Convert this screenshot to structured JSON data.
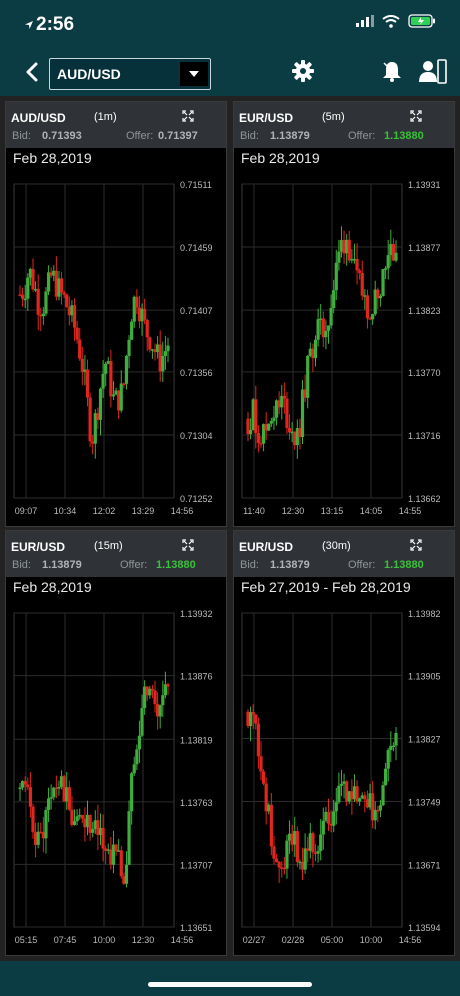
{
  "status": {
    "time": "2:56"
  },
  "nav": {
    "symbol": "AUD/USD"
  },
  "panels": [
    {
      "pair": "AUD/USD",
      "interval": "(1m)",
      "bid_label": "Bid:",
      "bid": "0.71393",
      "offer_label": "Offer:",
      "offer": "0.71397",
      "offer_color": "#b0b4b7",
      "date": "Feb 28,2019"
    },
    {
      "pair": "EUR/USD",
      "interval": "(5m)",
      "bid_label": "Bid:",
      "bid": "1.13879",
      "offer_label": "Offer:",
      "offer": "1.13880",
      "offer_color": "#39c23a",
      "date": "Feb 28,2019"
    },
    {
      "pair": "EUR/USD",
      "interval": "(15m)",
      "bid_label": "Bid:",
      "bid": "1.13879",
      "offer_label": "Offer:",
      "offer": "1.13880",
      "offer_color": "#39c23a",
      "date": "Feb 28,2019"
    },
    {
      "pair": "EUR/USD",
      "interval": "(30m)",
      "bid_label": "Bid:",
      "bid": "1.13879",
      "offer_label": "Offer:",
      "offer": "1.13880",
      "offer_color": "#39c23a",
      "date": "Feb 27,2019 - Feb 28,2019"
    }
  ],
  "chart_data": [
    {
      "type": "candlestick",
      "y_ticks": [
        "0.71511",
        "0.71459",
        "0.71407",
        "0.71356",
        "0.71304",
        "0.71252"
      ],
      "ylim": [
        0.71252,
        0.71511
      ],
      "x_ticks": [
        "09:07",
        "10:34",
        "12:02",
        "13:29",
        "14:56"
      ],
      "trend": [
        0.7142,
        0.71425,
        0.7144,
        0.7143,
        0.71415,
        0.7141,
        0.7142,
        0.71435,
        0.7143,
        0.7142,
        0.71415,
        0.71405,
        0.71395,
        0.7138,
        0.7136,
        0.7133,
        0.713,
        0.7132,
        0.71345,
        0.71365,
        0.7135,
        0.7133,
        0.71335,
        0.7134,
        0.7138,
        0.7141,
        0.7142,
        0.71405,
        0.7139,
        0.71385,
        0.71375,
        0.71365,
        0.7137,
        0.7138
      ],
      "colors": {
        "up": "#3fae3f",
        "down": "#e0261f"
      }
    },
    {
      "type": "candlestick",
      "y_ticks": [
        "1.13931",
        "1.13877",
        "1.13823",
        "1.13770",
        "1.13716",
        "1.13662"
      ],
      "ylim": [
        1.13662,
        1.13931
      ],
      "x_ticks": [
        "11:40",
        "12:30",
        "13:15",
        "14:05",
        "14:55"
      ],
      "trend": [
        1.1373,
        1.13735,
        1.1372,
        1.13715,
        1.13725,
        1.1374,
        1.13735,
        1.13745,
        1.1373,
        1.1372,
        1.1371,
        1.1374,
        1.1377,
        1.1379,
        1.1381,
        1.138,
        1.13815,
        1.1383,
        1.1386,
        1.1388,
        1.13885,
        1.1387,
        1.13845,
        1.1384,
        1.1383,
        1.13825,
        1.13835,
        1.1385,
        1.1387,
        1.1388,
        1.13875
      ],
      "colors": {
        "up": "#3fae3f",
        "down": "#e0261f"
      }
    },
    {
      "type": "candlestick",
      "y_ticks": [
        "1.13932",
        "1.13876",
        "1.13819",
        "1.13763",
        "1.13707",
        "1.13651"
      ],
      "ylim": [
        1.13651,
        1.13932
      ],
      "x_ticks": [
        "05:15",
        "07:45",
        "10:00",
        "12:30",
        "14:56"
      ],
      "trend": [
        1.13775,
        1.1377,
        1.1376,
        1.1374,
        1.13725,
        1.1374,
        1.1376,
        1.1377,
        1.1378,
        1.13775,
        1.1376,
        1.1375,
        1.1374,
        1.13755,
        1.13745,
        1.1373,
        1.13735,
        1.1373,
        1.1372,
        1.13715,
        1.13725,
        1.13705,
        1.1369,
        1.1376,
        1.1381,
        1.13835,
        1.1386,
        1.1387,
        1.1385,
        1.1384,
        1.1386,
        1.1387
      ],
      "colors": {
        "up": "#3fae3f",
        "down": "#e0261f"
      }
    },
    {
      "type": "candlestick",
      "y_ticks": [
        "1.13982",
        "1.13905",
        "1.13827",
        "1.13749",
        "1.13671",
        "1.13594"
      ],
      "ylim": [
        1.13594,
        1.13982
      ],
      "x_ticks": [
        "02/27",
        "02/28",
        "05:00",
        "10:00",
        "14:56"
      ],
      "trend": [
        1.1386,
        1.1385,
        1.1383,
        1.1379,
        1.1374,
        1.137,
        1.1367,
        1.1366,
        1.1369,
        1.1372,
        1.137,
        1.1368,
        1.1369,
        1.137,
        1.1369,
        1.137,
        1.1373,
        1.1372,
        1.1374,
        1.1376,
        1.1377,
        1.1376,
        1.1376,
        1.1375,
        1.1374,
        1.1376,
        1.1374,
        1.1373,
        1.1375,
        1.1379,
        1.1382,
        1.1384
      ],
      "colors": {
        "up": "#3fae3f",
        "down": "#e0261f"
      }
    }
  ]
}
